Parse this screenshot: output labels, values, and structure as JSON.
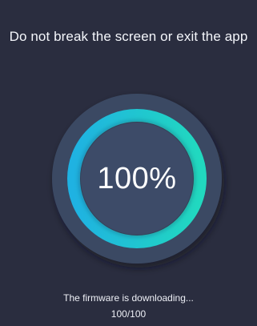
{
  "warning_text": "Do not break the screen or exit the app",
  "progress": {
    "fraction": 1.0,
    "percent_label": "100%",
    "count_label": "100/100",
    "status_text": "The firmware is downloading..."
  },
  "colors": {
    "background": "#2a2d3f",
    "disc": "#3b4a64",
    "inner": "#3e4c68",
    "ring_top": "#1fb2e2",
    "ring_bottom": "#21d9bf"
  }
}
